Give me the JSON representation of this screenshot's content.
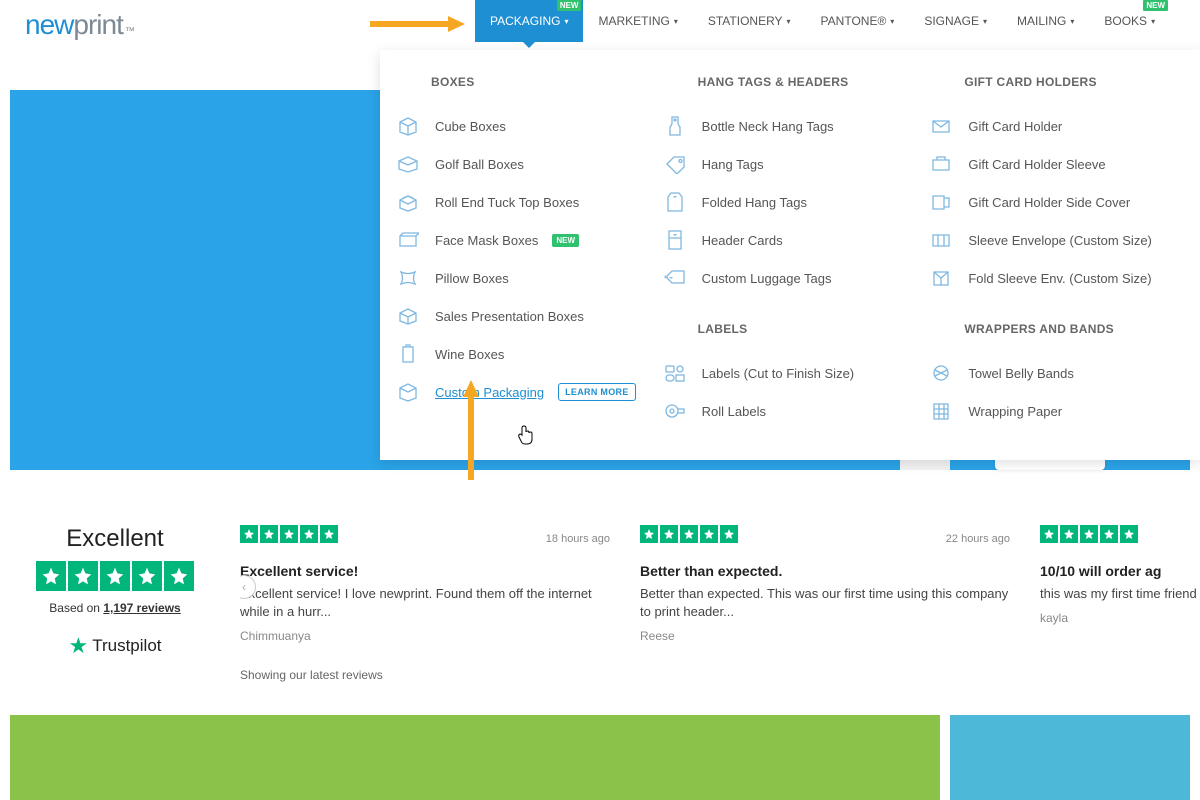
{
  "logo": {
    "part1": "new",
    "part2": "print",
    "tm": "™"
  },
  "nav": [
    {
      "label": "PACKAGING",
      "active": true,
      "new": true
    },
    {
      "label": "MARKETING"
    },
    {
      "label": "STATIONERY"
    },
    {
      "label": "PANTONE®"
    },
    {
      "label": "SIGNAGE"
    },
    {
      "label": "MAILING"
    },
    {
      "label": "BOOKS",
      "new": true
    }
  ],
  "new_badge": "NEW",
  "mega": {
    "col1": {
      "heading": "BOXES",
      "items": [
        {
          "label": "Cube Boxes"
        },
        {
          "label": "Golf Ball Boxes"
        },
        {
          "label": "Roll End Tuck Top Boxes"
        },
        {
          "label": "Face Mask Boxes",
          "new": true
        },
        {
          "label": "Pillow Boxes"
        },
        {
          "label": "Sales Presentation Boxes"
        },
        {
          "label": "Wine Boxes"
        },
        {
          "label": "Custom Packaging",
          "highlighted": true,
          "learnMore": "LEARN MORE"
        }
      ]
    },
    "col2": {
      "heading": "HANG TAGS & HEADERS",
      "items": [
        {
          "label": "Bottle Neck Hang Tags"
        },
        {
          "label": "Hang Tags"
        },
        {
          "label": "Folded Hang Tags"
        },
        {
          "label": "Header Cards"
        },
        {
          "label": "Custom Luggage Tags"
        }
      ],
      "heading2": "LABELS",
      "items2": [
        {
          "label": "Labels (Cut to Finish Size)"
        },
        {
          "label": "Roll Labels"
        }
      ]
    },
    "col3": {
      "heading": "GIFT CARD HOLDERS",
      "items": [
        {
          "label": "Gift Card Holder"
        },
        {
          "label": "Gift Card Holder Sleeve"
        },
        {
          "label": "Gift Card Holder Side Cover"
        },
        {
          "label": "Sleeve Envelope (Custom Size)"
        },
        {
          "label": "Fold Sleeve Env. (Custom Size)"
        }
      ],
      "heading2": "WRAPPERS AND BANDS",
      "items2": [
        {
          "label": "Towel Belly Bands"
        },
        {
          "label": "Wrapping Paper"
        }
      ]
    }
  },
  "trust": {
    "excellent": "Excellent",
    "based_prefix": "Based on ",
    "based_count": "1,197 reviews",
    "brand": "Trustpilot",
    "showing": "Showing our latest reviews"
  },
  "reviews": [
    {
      "time": "18 hours ago",
      "title": "Excellent service!",
      "body": "Excellent service! I love newprint. Found them off the internet while in a hurr...",
      "author": "Chimmuanya"
    },
    {
      "time": "22 hours ago",
      "title": "Better than expected.",
      "body": "Better than expected. This was our first time using this company to print header...",
      "author": "Reese"
    },
    {
      "time": "",
      "title": "10/10 will order ag",
      "body": "this was my first time\nfriend and I had a...",
      "author": "kayla"
    }
  ]
}
